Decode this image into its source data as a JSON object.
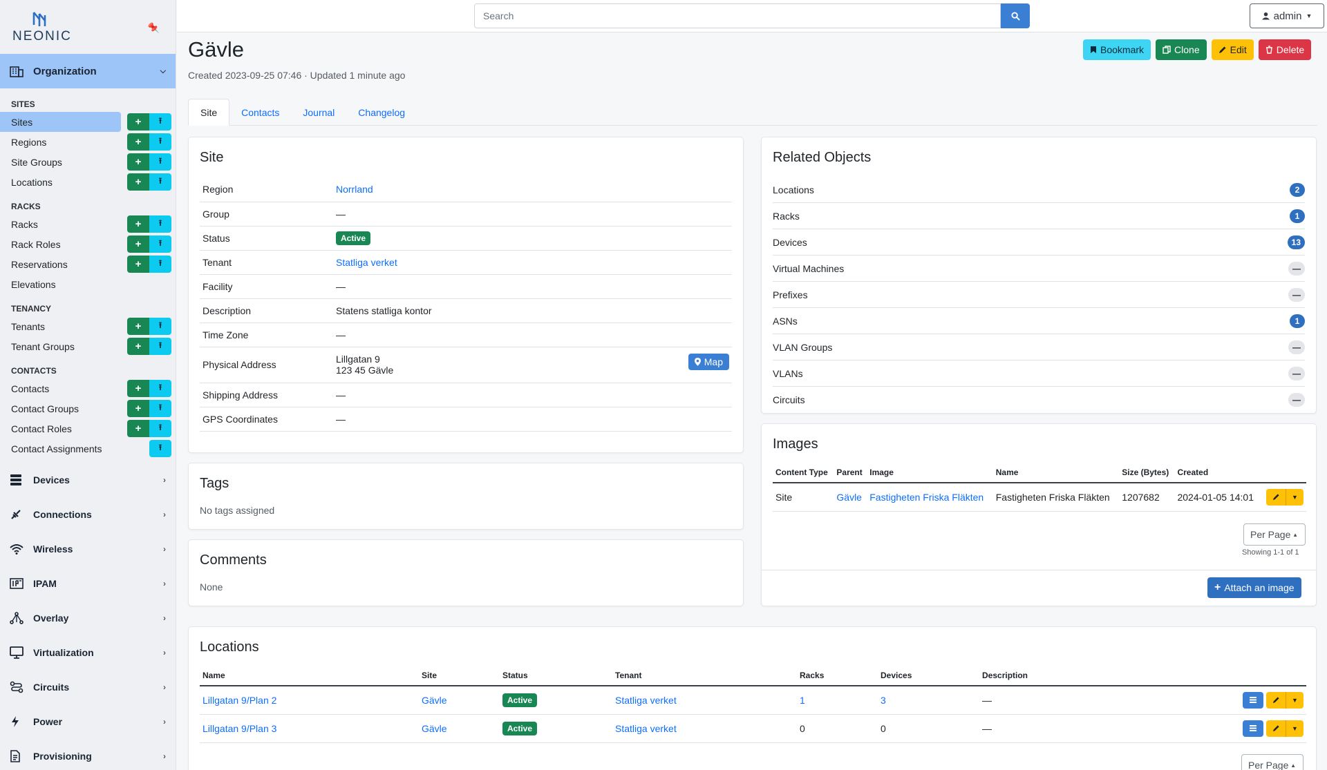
{
  "brand": {
    "name": "NEONIC"
  },
  "sidebar": {
    "menu_head": "Organization",
    "sections": [
      {
        "label": "SITES",
        "items": [
          {
            "label": "Sites",
            "active": true,
            "add": true,
            "import": true
          },
          {
            "label": "Regions",
            "add": true,
            "import": true
          },
          {
            "label": "Site Groups",
            "add": true,
            "import": true
          },
          {
            "label": "Locations",
            "add": true,
            "import": true
          }
        ]
      },
      {
        "label": "RACKS",
        "items": [
          {
            "label": "Racks",
            "add": true,
            "import": true
          },
          {
            "label": "Rack Roles",
            "add": true,
            "import": true
          },
          {
            "label": "Reservations",
            "add": true,
            "import": true
          },
          {
            "label": "Elevations"
          }
        ]
      },
      {
        "label": "TENANCY",
        "items": [
          {
            "label": "Tenants",
            "add": true,
            "import": true
          },
          {
            "label": "Tenant Groups",
            "add": true,
            "import": true
          }
        ]
      },
      {
        "label": "CONTACTS",
        "items": [
          {
            "label": "Contacts",
            "add": true,
            "import": true
          },
          {
            "label": "Contact Groups",
            "add": true,
            "import": true
          },
          {
            "label": "Contact Roles",
            "add": true,
            "import": true
          },
          {
            "label": "Contact Assignments",
            "import": true
          }
        ]
      }
    ],
    "groups": [
      {
        "label": "Devices",
        "icon": "server-icon"
      },
      {
        "label": "Connections",
        "icon": "plug-icon"
      },
      {
        "label": "Wireless",
        "icon": "wifi-icon"
      },
      {
        "label": "IPAM",
        "icon": "ipam-icon"
      },
      {
        "label": "Overlay",
        "icon": "overlay-icon"
      },
      {
        "label": "Virtualization",
        "icon": "monitor-icon"
      },
      {
        "label": "Circuits",
        "icon": "circuit-icon"
      },
      {
        "label": "Power",
        "icon": "lightning-icon"
      },
      {
        "label": "Provisioning",
        "icon": "document-icon"
      }
    ]
  },
  "topbar": {
    "search_placeholder": "Search",
    "user": "admin"
  },
  "header": {
    "title": "Gävle",
    "meta": "Created 2023-09-25 07:46 · Updated 1 minute ago",
    "actions": {
      "bookmark": "Bookmark",
      "clone": "Clone",
      "edit": "Edit",
      "delete": "Delete"
    }
  },
  "tabs": [
    "Site",
    "Contacts",
    "Journal",
    "Changelog"
  ],
  "site_card": {
    "title": "Site",
    "rows": {
      "region": {
        "k": "Region",
        "v": "Norrland"
      },
      "group": {
        "k": "Group",
        "v": "—"
      },
      "status": {
        "k": "Status",
        "v": "Active"
      },
      "tenant": {
        "k": "Tenant",
        "v": "Statliga verket"
      },
      "facility": {
        "k": "Facility",
        "v": "—"
      },
      "description": {
        "k": "Description",
        "v": "Statens statliga kontor"
      },
      "timezone": {
        "k": "Time Zone",
        "v": "—"
      },
      "physical": {
        "k": "Physical Address",
        "line1": "Lillgatan 9",
        "line2": "123 45 Gävle",
        "map": "Map"
      },
      "shipping": {
        "k": "Shipping Address",
        "v": "—"
      },
      "gps": {
        "k": "GPS Coordinates",
        "v": "—"
      }
    }
  },
  "tags_card": {
    "title": "Tags",
    "text": "No tags assigned"
  },
  "comments_card": {
    "title": "Comments",
    "text": "None"
  },
  "related": {
    "title": "Related Objects",
    "items": [
      {
        "label": "Locations",
        "count": "2"
      },
      {
        "label": "Racks",
        "count": "1"
      },
      {
        "label": "Devices",
        "count": "13"
      },
      {
        "label": "Virtual Machines",
        "count": "—"
      },
      {
        "label": "Prefixes",
        "count": "—"
      },
      {
        "label": "ASNs",
        "count": "1"
      },
      {
        "label": "VLAN Groups",
        "count": "—"
      },
      {
        "label": "VLANs",
        "count": "—"
      },
      {
        "label": "Circuits",
        "count": "—"
      }
    ]
  },
  "images": {
    "title": "Images",
    "headers": [
      "Content Type",
      "Parent",
      "Image",
      "Name",
      "Size (Bytes)",
      "Created"
    ],
    "row": {
      "content_type": "Site",
      "parent": "Gävle",
      "image": "Fastigheten Friska Fläkten",
      "name": "Fastigheten Friska Fläkten",
      "size": "1207682",
      "created": "2024-01-05 14:01"
    },
    "per_page": "Per Page",
    "showing": "Showing 1-1 of 1",
    "attach": "Attach an image"
  },
  "locations": {
    "title": "Locations",
    "headers": [
      "Name",
      "Site",
      "Status",
      "Tenant",
      "Racks",
      "Devices",
      "Description"
    ],
    "rows": [
      {
        "name": "Lillgatan 9/Plan 2",
        "site": "Gävle",
        "status": "Active",
        "tenant": "Statliga verket",
        "racks": "1",
        "devices": "3",
        "description": "—"
      },
      {
        "name": "Lillgatan 9/Plan 3",
        "site": "Gävle",
        "status": "Active",
        "tenant": "Statliga verket",
        "racks": "0",
        "devices": "0",
        "description": "—"
      }
    ],
    "per_page": "Per Page"
  }
}
